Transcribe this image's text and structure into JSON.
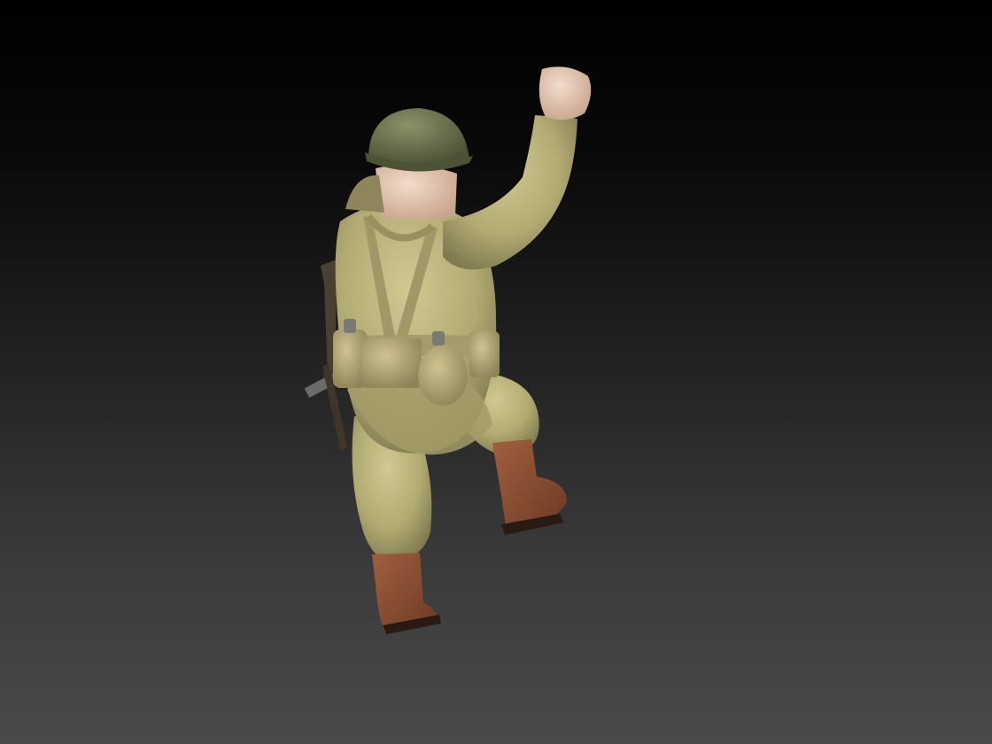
{
  "scene": {
    "subject": "soldier-figure",
    "background_top": "#000000",
    "background_bottom": "#4a4a4a",
    "colors": {
      "uniform": "#b7b07a",
      "uniform_shadow": "#8a8456",
      "helmet": "#6f7552",
      "webbing": "#a99e6e",
      "boots": "#8a4e32",
      "skin": "#e2c6b0",
      "metal": "#5a5a5a"
    }
  }
}
